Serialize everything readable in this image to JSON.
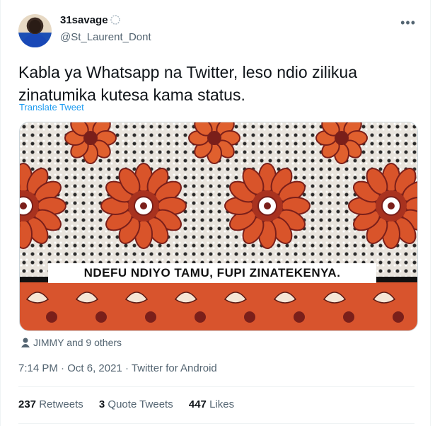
{
  "user": {
    "display_name": "31savage",
    "handle": "@St_Laurent_Dont"
  },
  "tweet": {
    "text_line1": "Kabla ya Whatsapp na Twitter, leso ndio zilikua",
    "text_line2": "zinatumika kutesa kama status.",
    "translate": "Translate Tweet"
  },
  "media": {
    "banner_text": "NDEFU NDIYO TAMU, FUPI ZINATEKENYA."
  },
  "liked_by": "JIMMY and 9 others",
  "meta": {
    "time": "7:14 PM",
    "date": "Oct 6, 2021",
    "source": "Twitter for Android",
    "separator": "·"
  },
  "stats": {
    "retweets_count": "237",
    "retweets_label": "Retweets",
    "quotes_count": "3",
    "quotes_label": "Quote Tweets",
    "likes_count": "447",
    "likes_label": "Likes"
  },
  "colors": {
    "accent": "#1d9bf0",
    "flower": "#d9542a",
    "flower_dark": "#7a1f1a"
  }
}
